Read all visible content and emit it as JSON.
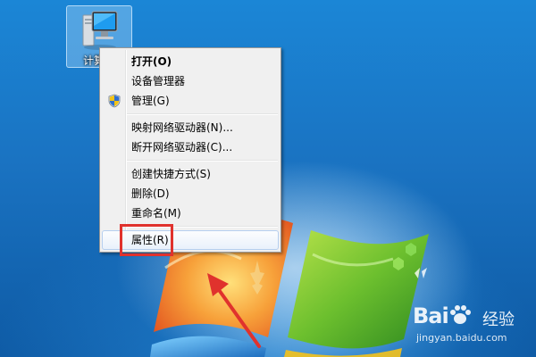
{
  "desktop": {
    "icon": {
      "label": "计算机",
      "icon_name": "computer-icon"
    }
  },
  "context_menu": {
    "items": [
      {
        "label": "打开(O)",
        "bold": true,
        "icon": null
      },
      {
        "label": "设备管理器",
        "bold": false,
        "icon": null
      },
      {
        "label": "管理(G)",
        "bold": false,
        "icon": "shield-icon"
      },
      {
        "label": "映射网络驱动器(N)...",
        "bold": false,
        "icon": null
      },
      {
        "label": "断开网络驱动器(C)...",
        "bold": false,
        "icon": null
      },
      {
        "label": "创建快捷方式(S)",
        "bold": false,
        "icon": null
      },
      {
        "label": "删除(D)",
        "bold": false,
        "icon": null
      },
      {
        "label": "重命名(M)",
        "bold": false,
        "icon": null
      },
      {
        "label": "属性(R)",
        "bold": false,
        "icon": null,
        "highlighted": true
      }
    ]
  },
  "watermark": {
    "logo": "Bai",
    "brand": "经验",
    "url": "jingyan.baidu.com"
  },
  "colors": {
    "annotation": "#e0322d",
    "menu_bg": "#f0f0f0",
    "highlight_border": "#b6cfef"
  }
}
